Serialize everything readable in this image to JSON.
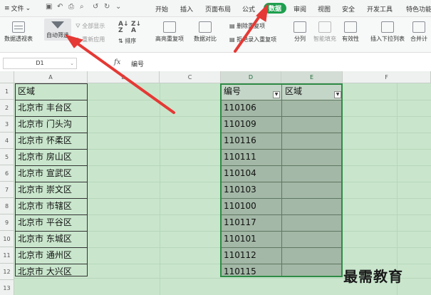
{
  "menubar": {
    "file_label": "文件",
    "tabs": [
      {
        "label": "开始"
      },
      {
        "label": "插入"
      },
      {
        "label": "页面布局"
      },
      {
        "label": "公式"
      },
      {
        "label": "数据"
      },
      {
        "label": "审阅"
      },
      {
        "label": "视图"
      },
      {
        "label": "安全"
      },
      {
        "label": "开发工具"
      },
      {
        "label": "特色功能"
      }
    ]
  },
  "ribbon": {
    "pivot": "数据透视表",
    "autofilter": "自动筛选",
    "show_all": "全部显示",
    "reapply": "重新应用",
    "sort": "排序",
    "highlight_dup": "高亮重复项",
    "compare": "数据对比",
    "remove_dup": "删除重复项",
    "reject_dup": "拒绝录入重复项",
    "split": "分列",
    "smart_fill": "智能填充",
    "validity": "有效性",
    "insert_dropdown": "插入下拉列表",
    "merge_calc": "合并计"
  },
  "formula_bar": {
    "cell_ref": "D1",
    "fx": "fx",
    "content": "编号"
  },
  "grid": {
    "columns": [
      "A",
      "B",
      "C",
      "D",
      "E",
      "F"
    ],
    "rows": [
      "1",
      "2",
      "3",
      "4",
      "5",
      "6",
      "7",
      "8",
      "9",
      "10",
      "11",
      "12",
      "13"
    ],
    "colA": [
      "区域",
      "北京市 丰台区",
      "北京市 门头沟",
      "北京市 怀柔区",
      "北京市 房山区",
      "北京市 宣武区",
      "北京市 崇文区",
      "北京市 市辖区",
      "北京市 平谷区",
      "北京市 东城区",
      "北京市 通州区",
      "北京市 大兴区"
    ],
    "colD": [
      "编号",
      "110106",
      "110109",
      "110116",
      "110111",
      "110104",
      "110103",
      "110100",
      "110117",
      "110101",
      "110112",
      "110115"
    ],
    "colE_header": "区域"
  },
  "watermark": "最需教育",
  "colors": {
    "accent": "#1e9f4f",
    "grid_bg": "#c9e6cc",
    "selection_fill": "#a3b8a6",
    "arrow": "#e53935"
  }
}
